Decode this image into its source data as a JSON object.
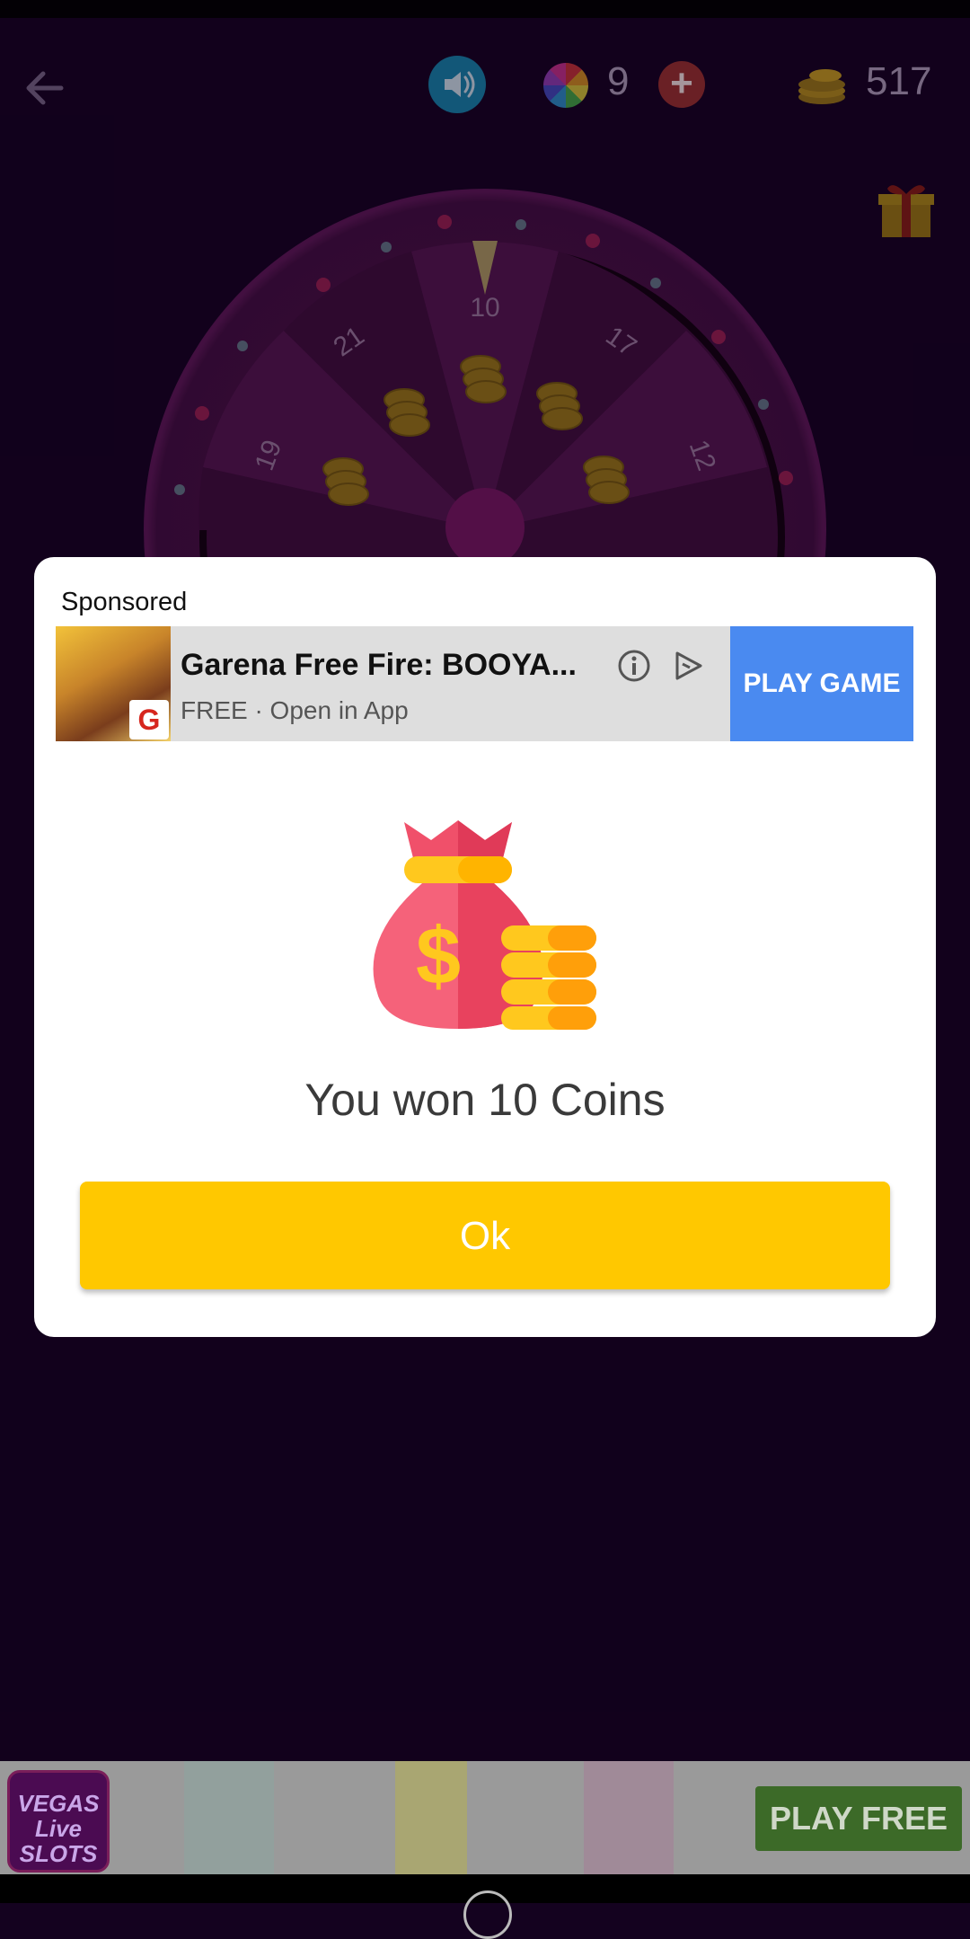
{
  "topbar": {
    "spins_remaining": "9",
    "coin_balance": "517"
  },
  "wheel": {
    "segment_labels": [
      "10",
      "17",
      "12",
      "21",
      "19"
    ]
  },
  "dialog": {
    "sponsored_label": "Sponsored",
    "ad": {
      "thumb_logo": "G",
      "title": "Garena Free Fire: BOOYA...",
      "subtitle": "FREE · Open in App",
      "cta": "PLAY GAME"
    },
    "message": "You won 10 Coins",
    "ok_label": "Ok"
  },
  "banner": {
    "logo_text": "VEGAS Live SLOTS",
    "cta": "PLAY FREE"
  },
  "colors": {
    "background": "#14021f",
    "ok_button": "#ffc800",
    "ad_cta": "#4a8af0",
    "banner_cta": "#3c6a28"
  }
}
